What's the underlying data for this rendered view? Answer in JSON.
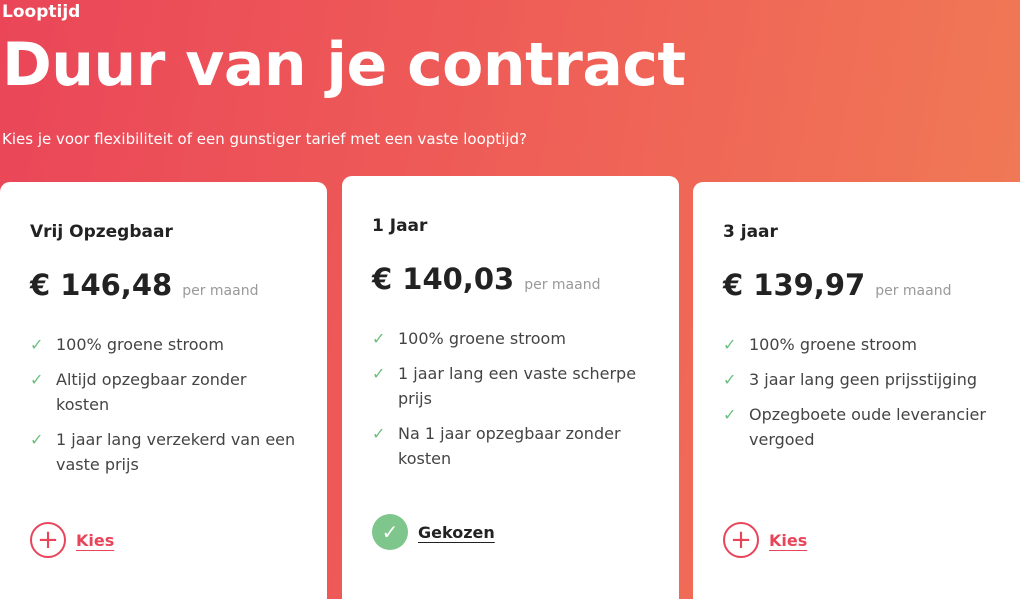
{
  "header": {
    "eyebrow": "Looptijd",
    "title": "Duur van je contract",
    "subtitle": "Kies je voor flexibiliteit of een gunstiger tarief met een vaste looptijd?"
  },
  "plans": [
    {
      "name": "Vrij Opzegbaar",
      "price": "€ 146,48",
      "per": "per maand",
      "features": [
        "100% groene stroom",
        "Altijd opzegbaar zonder kosten",
        "1 jaar lang verzekerd van een vaste prijs"
      ],
      "action": "Kies",
      "selected": false
    },
    {
      "name": "1 Jaar",
      "price": "€ 140,03",
      "per": "per maand",
      "features": [
        "100% groene stroom",
        "1 jaar lang een vaste scherpe prijs",
        "Na 1 jaar opzegbaar zonder kosten"
      ],
      "action": "Gekozen",
      "selected": true
    },
    {
      "name": "3 jaar",
      "price": "€ 139,97",
      "per": "per maand",
      "features": [
        "100% groene stroom",
        "3 jaar lang geen prijsstijging",
        "Opzegboete oude leverancier vergoed"
      ],
      "action": "Kies",
      "selected": false
    }
  ],
  "colors": {
    "accent": "#e8455a",
    "check": "#7ec68b"
  },
  "icons": {
    "feature": "check-icon",
    "choose": "plus-circle-icon",
    "chosen": "check-circle-icon"
  }
}
